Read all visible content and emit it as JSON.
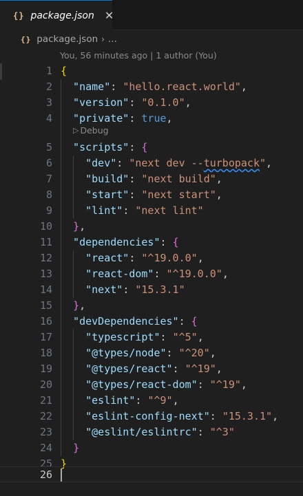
{
  "tab": {
    "icon_text": "{}",
    "label": "package.json",
    "close_glyph": "✕"
  },
  "breadcrumb": {
    "icon_text": "{}",
    "file": "package.json",
    "separator": "›",
    "more": "..."
  },
  "blame": "You, 56 minutes ago | 1 author (You)",
  "codelens": {
    "icon": "▷",
    "label": "Debug"
  },
  "colors": {
    "key": "#9cdcfe",
    "string": "#ce9178",
    "boolean": "#569cd6",
    "bracket_outer": "#ffd700",
    "bracket_inner": "#da70d6"
  },
  "lines": [
    {
      "num": "1",
      "tokens": [
        {
          "t": "br1",
          "v": "{"
        }
      ]
    },
    {
      "num": "2",
      "tokens": [
        {
          "t": "k",
          "v": "  \"name\""
        },
        {
          "t": "p",
          "v": ": "
        },
        {
          "t": "s",
          "v": "\"hello.react.world\""
        },
        {
          "t": "p",
          "v": ","
        }
      ]
    },
    {
      "num": "3",
      "tokens": [
        {
          "t": "k",
          "v": "  \"version\""
        },
        {
          "t": "p",
          "v": ": "
        },
        {
          "t": "s",
          "v": "\"0.1.0\""
        },
        {
          "t": "p",
          "v": ","
        }
      ]
    },
    {
      "num": "4",
      "tokens": [
        {
          "t": "k",
          "v": "  \"private\""
        },
        {
          "t": "p",
          "v": ": "
        },
        {
          "t": "b",
          "v": "true"
        },
        {
          "t": "p",
          "v": ","
        }
      ]
    },
    {
      "num": "5",
      "tokens": [
        {
          "t": "k",
          "v": "  \"scripts\""
        },
        {
          "t": "p",
          "v": ": "
        },
        {
          "t": "br2",
          "v": "{"
        }
      ]
    },
    {
      "num": "6",
      "tokens": [
        {
          "t": "k",
          "v": "    \"dev\""
        },
        {
          "t": "p",
          "v": ": "
        },
        {
          "t": "s",
          "v": "\"next dev --"
        },
        {
          "t": "s squiggle",
          "v": "turbopack"
        },
        {
          "t": "s",
          "v": "\""
        },
        {
          "t": "p",
          "v": ","
        }
      ]
    },
    {
      "num": "7",
      "tokens": [
        {
          "t": "k",
          "v": "    \"build\""
        },
        {
          "t": "p",
          "v": ": "
        },
        {
          "t": "s",
          "v": "\"next build\""
        },
        {
          "t": "p",
          "v": ","
        }
      ]
    },
    {
      "num": "8",
      "tokens": [
        {
          "t": "k",
          "v": "    \"start\""
        },
        {
          "t": "p",
          "v": ": "
        },
        {
          "t": "s",
          "v": "\"next start\""
        },
        {
          "t": "p",
          "v": ","
        }
      ]
    },
    {
      "num": "9",
      "tokens": [
        {
          "t": "k",
          "v": "    \"lint\""
        },
        {
          "t": "p",
          "v": ": "
        },
        {
          "t": "s",
          "v": "\"next lint\""
        }
      ]
    },
    {
      "num": "10",
      "tokens": [
        {
          "t": "p",
          "v": "  "
        },
        {
          "t": "br2",
          "v": "}"
        },
        {
          "t": "p",
          "v": ","
        }
      ]
    },
    {
      "num": "11",
      "tokens": [
        {
          "t": "k",
          "v": "  \"dependencies\""
        },
        {
          "t": "p",
          "v": ": "
        },
        {
          "t": "br2",
          "v": "{"
        }
      ]
    },
    {
      "num": "12",
      "tokens": [
        {
          "t": "k",
          "v": "    \"react\""
        },
        {
          "t": "p",
          "v": ": "
        },
        {
          "t": "s",
          "v": "\"^19.0.0\""
        },
        {
          "t": "p",
          "v": ","
        }
      ]
    },
    {
      "num": "13",
      "tokens": [
        {
          "t": "k",
          "v": "    \"react-dom\""
        },
        {
          "t": "p",
          "v": ": "
        },
        {
          "t": "s",
          "v": "\"^19.0.0\""
        },
        {
          "t": "p",
          "v": ","
        }
      ]
    },
    {
      "num": "14",
      "tokens": [
        {
          "t": "k",
          "v": "    \"next\""
        },
        {
          "t": "p",
          "v": ": "
        },
        {
          "t": "s",
          "v": "\"15.3.1\""
        }
      ]
    },
    {
      "num": "15",
      "tokens": [
        {
          "t": "p",
          "v": "  "
        },
        {
          "t": "br2",
          "v": "}"
        },
        {
          "t": "p",
          "v": ","
        }
      ]
    },
    {
      "num": "16",
      "tokens": [
        {
          "t": "k",
          "v": "  \"devDependencies\""
        },
        {
          "t": "p",
          "v": ": "
        },
        {
          "t": "br2",
          "v": "{"
        }
      ]
    },
    {
      "num": "17",
      "tokens": [
        {
          "t": "k",
          "v": "    \"typescript\""
        },
        {
          "t": "p",
          "v": ": "
        },
        {
          "t": "s",
          "v": "\"^5\""
        },
        {
          "t": "p",
          "v": ","
        }
      ]
    },
    {
      "num": "18",
      "tokens": [
        {
          "t": "k",
          "v": "    \"@types/node\""
        },
        {
          "t": "p",
          "v": ": "
        },
        {
          "t": "s",
          "v": "\"^20\""
        },
        {
          "t": "p",
          "v": ","
        }
      ]
    },
    {
      "num": "19",
      "tokens": [
        {
          "t": "k",
          "v": "    \"@types/react\""
        },
        {
          "t": "p",
          "v": ": "
        },
        {
          "t": "s",
          "v": "\"^19\""
        },
        {
          "t": "p",
          "v": ","
        }
      ]
    },
    {
      "num": "20",
      "tokens": [
        {
          "t": "k",
          "v": "    \"@types/react-dom\""
        },
        {
          "t": "p",
          "v": ": "
        },
        {
          "t": "s",
          "v": "\"^19\""
        },
        {
          "t": "p",
          "v": ","
        }
      ]
    },
    {
      "num": "21",
      "tokens": [
        {
          "t": "k",
          "v": "    \"eslint\""
        },
        {
          "t": "p",
          "v": ": "
        },
        {
          "t": "s",
          "v": "\"^9\""
        },
        {
          "t": "p",
          "v": ","
        }
      ]
    },
    {
      "num": "22",
      "tokens": [
        {
          "t": "k",
          "v": "    \"eslint-config-next\""
        },
        {
          "t": "p",
          "v": ": "
        },
        {
          "t": "s",
          "v": "\"15.3.1\""
        },
        {
          "t": "p",
          "v": ","
        }
      ]
    },
    {
      "num": "23",
      "tokens": [
        {
          "t": "k",
          "v": "    \"@eslint/eslintrc\""
        },
        {
          "t": "p",
          "v": ": "
        },
        {
          "t": "s",
          "v": "\"^3\""
        }
      ]
    },
    {
      "num": "24",
      "tokens": [
        {
          "t": "p",
          "v": "  "
        },
        {
          "t": "br2",
          "v": "}"
        }
      ]
    },
    {
      "num": "25",
      "tokens": [
        {
          "t": "br1",
          "v": "}"
        }
      ]
    },
    {
      "num": "26",
      "tokens": []
    }
  ]
}
